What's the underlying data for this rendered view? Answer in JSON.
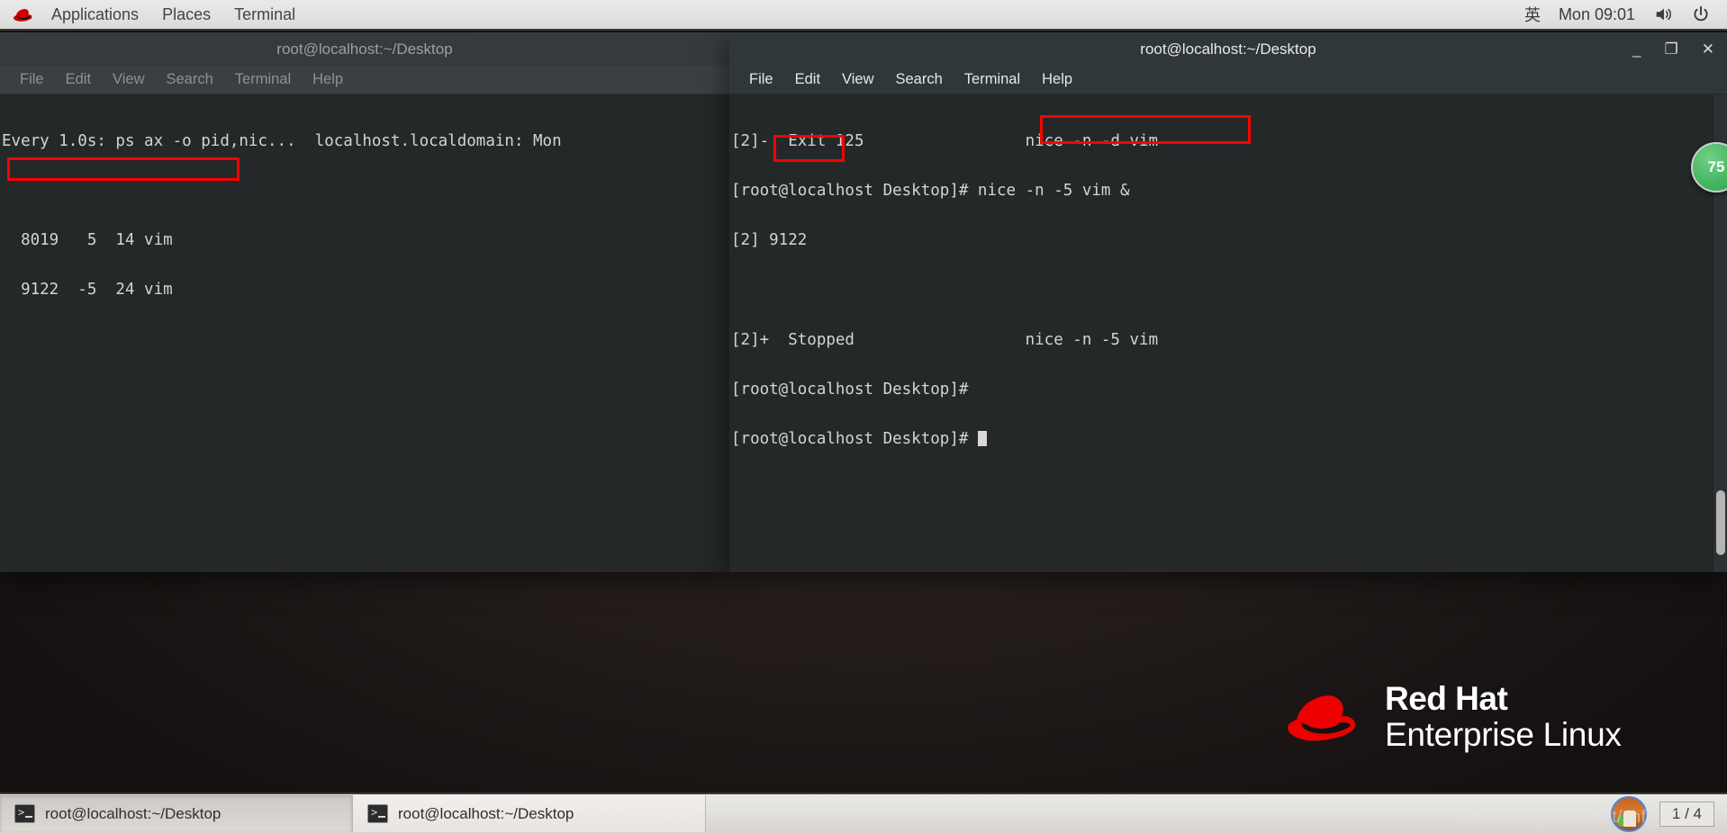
{
  "top_panel": {
    "logo_icon": "redhat-logo-icon",
    "menus": [
      "Applications",
      "Places",
      "Terminal"
    ],
    "ime": "英",
    "clock": "Mon 09:01",
    "volume_icon": "volume-icon",
    "power_icon": "power-icon"
  },
  "left_window": {
    "title": "root@localhost:~/Desktop",
    "menus": [
      "File",
      "Edit",
      "View",
      "Search",
      "Terminal",
      "Help"
    ],
    "lines": [
      "Every 1.0s: ps ax -o pid,nic...  localhost.localdomain: Mon",
      "",
      "  8019   5  14 vim",
      "  9122  -5  24 vim"
    ]
  },
  "right_window": {
    "title": "root@localhost:~/Desktop",
    "menus": [
      "File",
      "Edit",
      "View",
      "Search",
      "Terminal",
      "Help"
    ],
    "controls": {
      "minimize": "_",
      "maximize": "❐",
      "close": "✕"
    },
    "lines": [
      "[2]-  Exit 125                 nice -n -d vim",
      "[root@localhost Desktop]# nice -n -5 vim &",
      "[2] 9122",
      "",
      "[2]+  Stopped                  nice -n -5 vim",
      "[root@localhost Desktop]#",
      "[root@localhost Desktop]# "
    ]
  },
  "annotations": {
    "color": "#ff0000",
    "boxes": [
      {
        "name": "left-nice-row",
        "text": "9122  -5  24 vim"
      },
      {
        "name": "nice-command",
        "text": "nice -n -5 vim &"
      },
      {
        "name": "job-pid",
        "text": "9122"
      }
    ]
  },
  "green_badge": {
    "value": "75"
  },
  "wallpaper": {
    "brand_line1": "Red Hat",
    "brand_line2": "Enterprise Linux",
    "logo_icon": "redhat-hat-icon"
  },
  "taskbar": {
    "buttons": [
      {
        "label": "root@localhost:~/Desktop",
        "icon": "terminal-icon",
        "state": "pressed"
      },
      {
        "label": "root@localhost:~/Desktop",
        "icon": "terminal-icon",
        "state": "normal"
      }
    ],
    "avatar_icon": "user-avatar",
    "workspace": "1 / 4"
  },
  "watermark": "https://blog.csdn.net/snfj_4G"
}
